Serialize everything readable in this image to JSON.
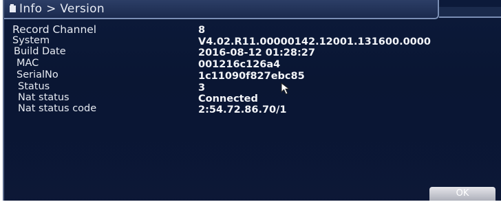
{
  "window": {
    "title": "Info > Version"
  },
  "info": {
    "rows": [
      {
        "label": "Record Channel",
        "value": "8"
      },
      {
        "label": "System",
        "value": "V4.02.R11.00000142.12001.131600.0000"
      },
      {
        "label": "Build Date",
        "value": "2016-08-12 01:28:27"
      },
      {
        "label": "MAC",
        "value": "001216c126a4"
      },
      {
        "label": "SerialNo",
        "value": "1c11090f827ebc85"
      },
      {
        "label": "Status",
        "value": "3"
      },
      {
        "label": "Nat status",
        "value": "Connected"
      },
      {
        "label": "Nat status code",
        "value": "2:54.72.86.70/1"
      }
    ]
  },
  "buttons": {
    "ok_label": "OK"
  },
  "icons": {
    "title": "info-folder-icon",
    "cursor": "mouse-pointer-icon"
  },
  "colors": {
    "background": "#0b1736",
    "text": "#e6eaf2",
    "title_bar": "#2c3e66"
  }
}
